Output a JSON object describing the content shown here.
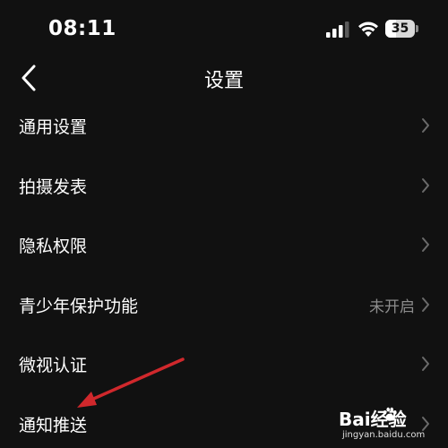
{
  "status_bar": {
    "time": "08:11",
    "battery_level": "35",
    "battery_fraction": 0.35
  },
  "nav": {
    "title": "设置",
    "back_icon": "chevron-left-icon"
  },
  "settings": {
    "items": [
      {
        "label": "通用设置",
        "value": "",
        "icon": "chevron-right-icon"
      },
      {
        "label": "拍摄发表",
        "value": "",
        "icon": "chevron-right-icon"
      },
      {
        "label": "隐私权限",
        "value": "",
        "icon": "chevron-right-icon"
      },
      {
        "label": "青少年保护功能",
        "value": "未开启",
        "icon": "chevron-right-icon"
      },
      {
        "label": "微视认证",
        "value": "",
        "icon": "chevron-right-icon"
      },
      {
        "label": "通知推送",
        "value": "",
        "icon": "chevron-right-icon"
      }
    ]
  },
  "watermark": {
    "logo_text": "Bai经验",
    "url": "jingyan.baidu.com"
  },
  "colors": {
    "background": "#111111",
    "text": "#ffffff",
    "secondary_text": "#8c8c8c",
    "chevron": "#6b6b6b",
    "annotation_arrow": "#d0282c"
  }
}
